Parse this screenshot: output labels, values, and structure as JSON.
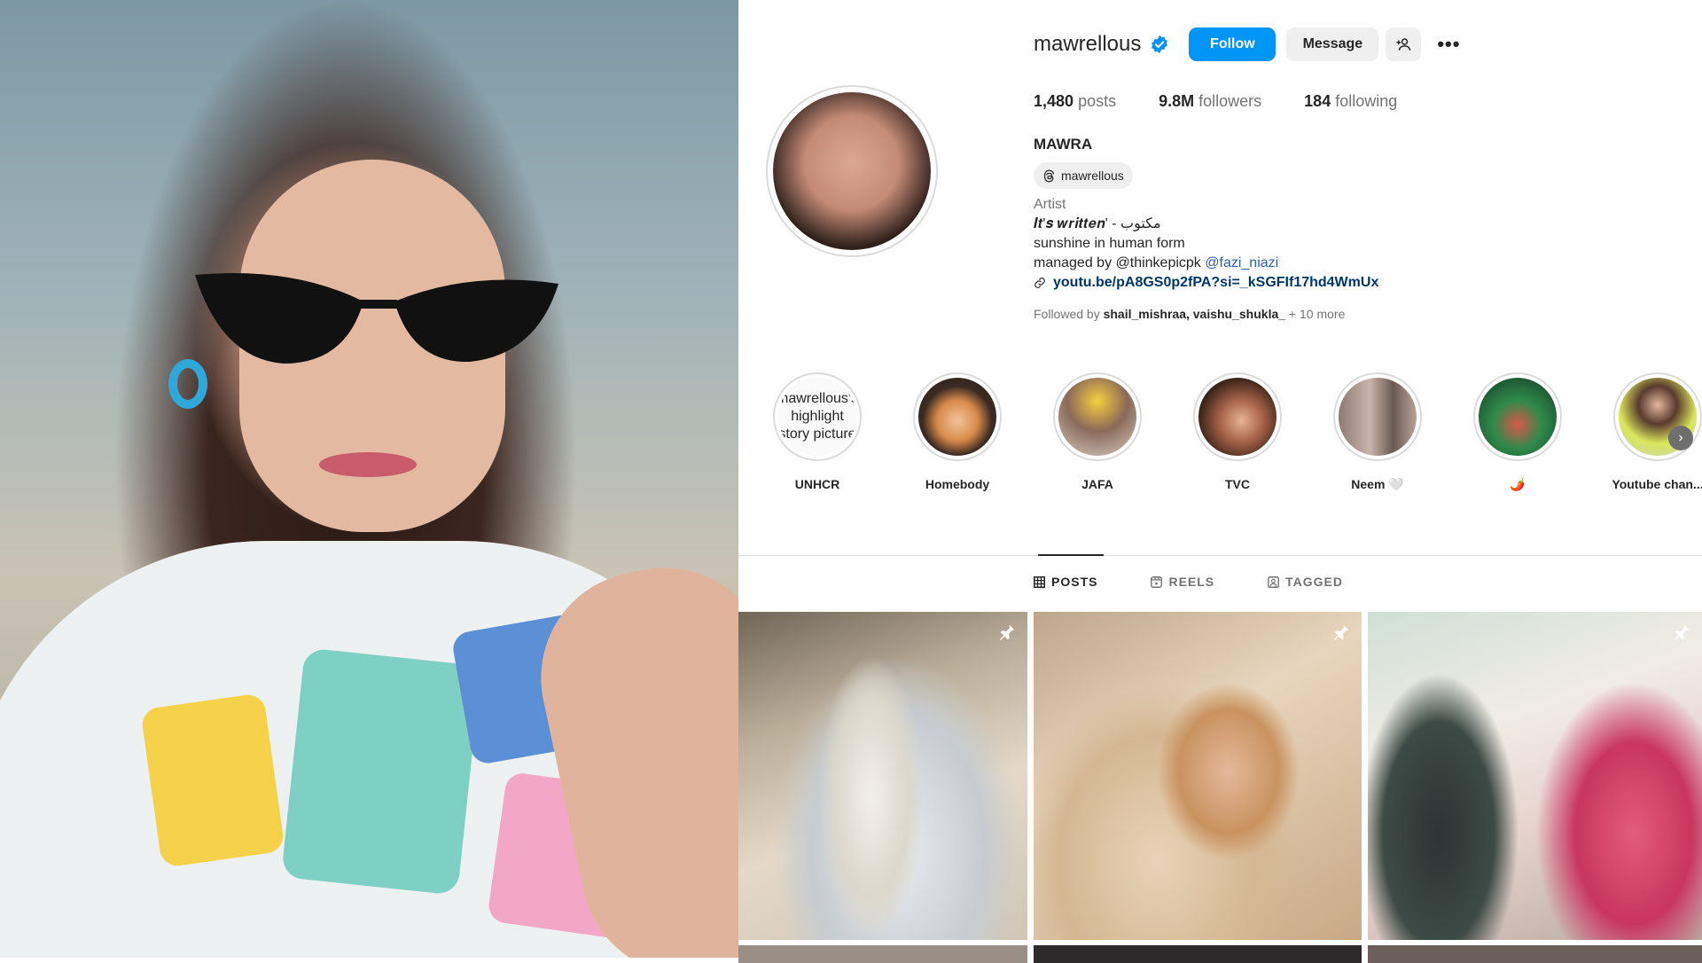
{
  "profile": {
    "username": "mawrellous",
    "follow_label": "Follow",
    "message_label": "Message",
    "more_label": "•••",
    "stats": {
      "posts_count": "1,480",
      "posts_label": "posts",
      "followers_count": "9.8M",
      "followers_label": "followers",
      "following_count": "184",
      "following_label": "following"
    },
    "name": "MAWRA",
    "threads_handle": "mawrellous",
    "category": "Artist",
    "bio_line1": "𝑰𝒕'𝒔 𝒘𝒓𝒊𝒕𝒕𝒆𝒏' - مکتوب",
    "bio_line2": "sunshine in human form",
    "bio_line3_text": "managed by @thinkepicpk ",
    "bio_line3_mention": "@fazi_niazi",
    "link": "youtu.be/pA8GS0p2fPA?si=_kSGFIf17hd4WmUx",
    "followed_by_prefix": "Followed by ",
    "followed_by_names": "shail_mishraa, vaishu_shukla_",
    "followed_by_more": " + 10 more"
  },
  "highlights": [
    {
      "label": "UNHCR",
      "alt_text": "mawrellous's highlight story picture"
    },
    {
      "label": "Homebody"
    },
    {
      "label": "JAFA"
    },
    {
      "label": "TVC"
    },
    {
      "label": "Neem 🤍"
    },
    {
      "label": "🌶️"
    },
    {
      "label": "Youtube chan..."
    }
  ],
  "tabs": [
    {
      "label": "POSTS",
      "active": true
    },
    {
      "label": "REELS",
      "active": false
    },
    {
      "label": "TAGGED",
      "active": false
    }
  ],
  "colors": {
    "accent": "#0095f6",
    "text": "#262626",
    "muted": "#737373",
    "link": "#00376b"
  }
}
